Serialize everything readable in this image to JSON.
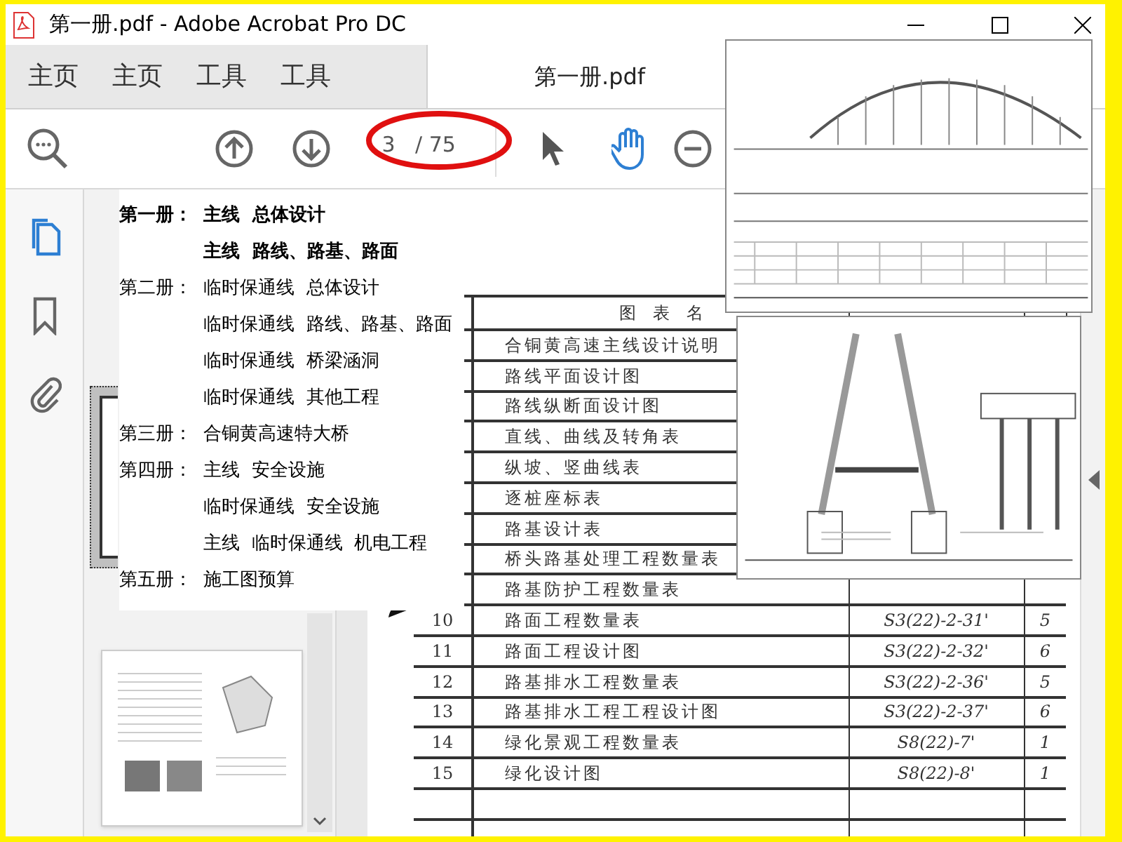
{
  "window": {
    "title": "第一册.pdf - Adobe Acrobat Pro DC"
  },
  "tabs": [
    {
      "label": "主页",
      "selected": false
    },
    {
      "label": "主页",
      "selected": false
    },
    {
      "label": "工具",
      "selected": false
    },
    {
      "label": "工具",
      "selected": false
    },
    {
      "label": "第一册.pdf",
      "selected": true
    }
  ],
  "toolbar": {
    "page_value": "3",
    "page_total": "/ 75",
    "tools": [
      {
        "kind": "select",
        "selected": false
      },
      {
        "kind": "hand",
        "selected": true
      }
    ]
  },
  "sidebar": {
    "items": [
      {
        "kind": "pages",
        "selected": true
      },
      {
        "kind": "bookmarks",
        "selected": false
      },
      {
        "kind": "attachments",
        "selected": false
      }
    ]
  },
  "thumbnails": [
    {
      "selected": true
    },
    {
      "selected": false
    }
  ],
  "table": {
    "columns": [
      "图　表　名"
    ],
    "rows": [
      {
        "number": "",
        "name": "合铜黄高速主线设计说明",
        "code": "",
        "pages": ""
      },
      {
        "number": "",
        "name": "路线平面设计图",
        "code": "",
        "pages": ""
      },
      {
        "number": "",
        "name": "路线纵断面设计图",
        "code": "",
        "pages": ""
      },
      {
        "number": "",
        "name": "直线、曲线及转角表",
        "code": "",
        "pages": ""
      },
      {
        "number": "",
        "name": "纵坡、竖曲线表",
        "code": "",
        "pages": ""
      },
      {
        "number": "",
        "name": "逐桩座标表",
        "code": "",
        "pages": ""
      },
      {
        "number": "",
        "name": "路基设计表",
        "code": "",
        "pages": ""
      },
      {
        "number": "",
        "name": "桥头路基处理工程数量表",
        "code": "",
        "pages": ""
      },
      {
        "number": "",
        "name": "路基防护工程数量表",
        "code": "",
        "pages": ""
      },
      {
        "number": "10",
        "name": "路面工程数量表",
        "code": "S3(22)-2-31'",
        "pages": "5"
      },
      {
        "number": "11",
        "name": "路面工程设计图",
        "code": "S3(22)-2-32'",
        "pages": "6"
      },
      {
        "number": "12",
        "name": "路基排水工程数量表",
        "code": "S3(22)-2-36'",
        "pages": "5"
      },
      {
        "number": "13",
        "name": "路基排水工程工程设计图",
        "code": "S3(22)-2-37'",
        "pages": "6"
      },
      {
        "number": "14",
        "name": "绿化景观工程数量表",
        "code": "S8(22)-7'",
        "pages": "1"
      },
      {
        "number": "15",
        "name": "绿化设计图",
        "code": "S8(22)-8'",
        "pages": "1"
      }
    ]
  },
  "volume_list": [
    {
      "label": "第一册：",
      "text": "主线  总体设计",
      "bold": true
    },
    {
      "text": "主线  路线、路基、路面",
      "bold": true
    },
    {
      "label": "第二册：",
      "text": "临时保通线  总体设计",
      "bold": false
    },
    {
      "text": "临时保通线  路线、路基、路面",
      "bold": false
    },
    {
      "text": "临时保通线  桥梁涵洞",
      "bold": false
    },
    {
      "text": "临时保通线  其他工程",
      "bold": false
    },
    {
      "label": "第三册：",
      "text": "合铜黄高速特大桥",
      "bold": false
    },
    {
      "label": "第四册：",
      "text": "主线  安全设施",
      "bold": false
    },
    {
      "text": "临时保通线  安全设施",
      "bold": false
    },
    {
      "text": "主线  临时保通线  机电工程",
      "bold": false
    },
    {
      "label": "第五册：",
      "text": "施工图预算",
      "bold": false
    }
  ]
}
